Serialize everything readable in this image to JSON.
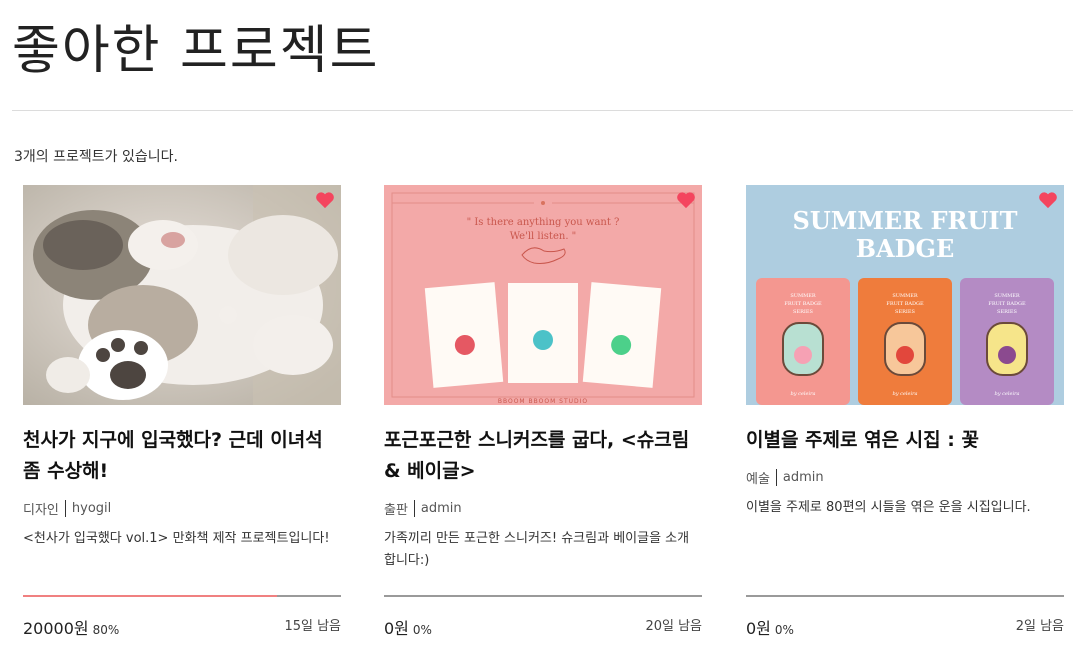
{
  "page": {
    "title": "좋아한 프로젝트",
    "count_text": "3개의 프로젝트가 있습니다."
  },
  "colors": {
    "heart": "#f4455e",
    "progress_fill": "#f08080",
    "progress_track": "#9a9a9a"
  },
  "projects": [
    {
      "image": "kitten-photo",
      "title": "천사가 지구에 입국했다? 근데 이녀석 좀 수상해!",
      "category": "디자인",
      "author": "hyogil",
      "description": "<천사가 입국했다 vol.1> 만화책 제작 프로젝트입니다!",
      "amount": "20000원",
      "percent": "80%",
      "progress": 0.8,
      "remaining": "15일 남음",
      "liked": true
    },
    {
      "image": "sneakers-illustration",
      "image_text": {
        "quote_line1": "\" Is there anything you want ?",
        "quote_line2": "We'll listen. \"",
        "studio": "BBOOM BBOOM STUDIO"
      },
      "title": "포근포근한 스니커즈를 굽다, <슈크림 & 베이글>",
      "category": "출판",
      "author": "admin",
      "description": "가족끼리 만든 포근한 스니커즈! 슈크림과 베이글을 소개합니다:)",
      "amount": "0원",
      "percent": "0%",
      "progress": 0,
      "remaining": "20일 남음",
      "liked": true
    },
    {
      "image": "summer-fruit-badge-poster",
      "image_text": {
        "headline_1": "SUMMER FRUIT",
        "headline_2": "BADGE",
        "panel_text_1": "SUMMER",
        "panel_text_2": "FRUIT BADGE",
        "panel_text_3": "SERIES",
        "signature": "by celeira"
      },
      "title": "이별을 주제로 엮은 시집 : 꽃",
      "category": "예술",
      "author": "admin",
      "description": "이별을 주제로 80편의 시들을 엮은 운을 시집입니다.",
      "amount": "0원",
      "percent": "0%",
      "progress": 0,
      "remaining": "2일 남음",
      "liked": true
    }
  ]
}
